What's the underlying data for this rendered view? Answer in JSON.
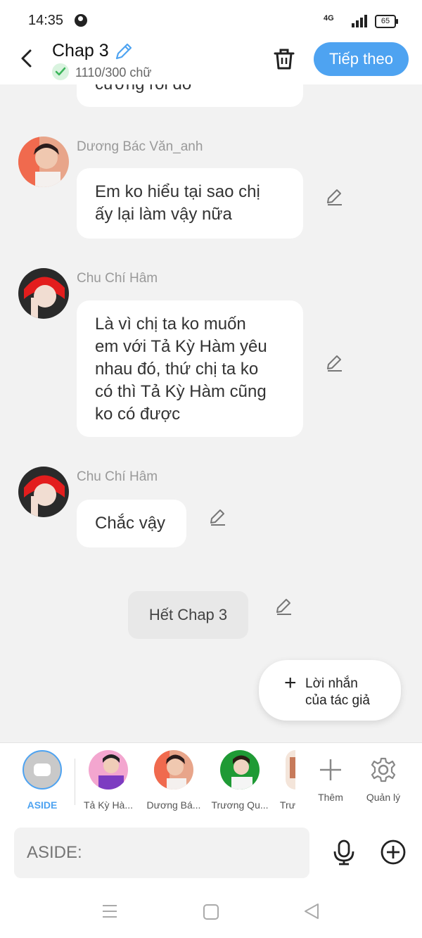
{
  "status": {
    "time": "14:35",
    "network": "4G",
    "battery": "65"
  },
  "header": {
    "title": "Chap 3",
    "word_count": "1110/300 chữ",
    "next_label": "Tiếp theo"
  },
  "messages": [
    {
      "text_cut": "cường rồi đó"
    },
    {
      "sender": "Dương Bác Văn_anh",
      "line1": "Em ko hiểu tại sao chị",
      "line2": "ấy lại làm vậy nữa"
    },
    {
      "sender": "Chu Chí Hâm",
      "line1": "Là vì chị ta ko muốn",
      "line2": "em với Tả Kỳ Hàm yêu",
      "line3": "nhau đó, thứ chị ta ko",
      "line4": "có thì Tả Kỳ Hàm cũng",
      "line5": "ko có được"
    },
    {
      "sender": "Chu Chí Hâm",
      "line1": "Chắc vậy"
    }
  ],
  "end_label": "Hết Chap 3",
  "author_note": {
    "plus": "+",
    "line1": "Lời nhắn",
    "line2": "của tác giả"
  },
  "characters": [
    {
      "label": "ASIDE"
    },
    {
      "label": "Tả Kỳ Hà..."
    },
    {
      "label": "Dương Bá..."
    },
    {
      "label": "Trương Qu..."
    },
    {
      "label": "Trư"
    }
  ],
  "actions": {
    "add_label": "Thêm",
    "manage_label": "Quản lý"
  },
  "input": {
    "placeholder": "ASIDE:"
  },
  "icons": [
    "back-arrow-icon",
    "pencil-icon",
    "check-icon",
    "trash-icon",
    "plus-icon",
    "gear-icon",
    "microphone-icon",
    "add-circle-icon",
    "menu-icon",
    "home-square-icon",
    "back-triangle-icon"
  ],
  "colors": {
    "accent": "#4ea3f1",
    "background": "#f2f2f2"
  }
}
